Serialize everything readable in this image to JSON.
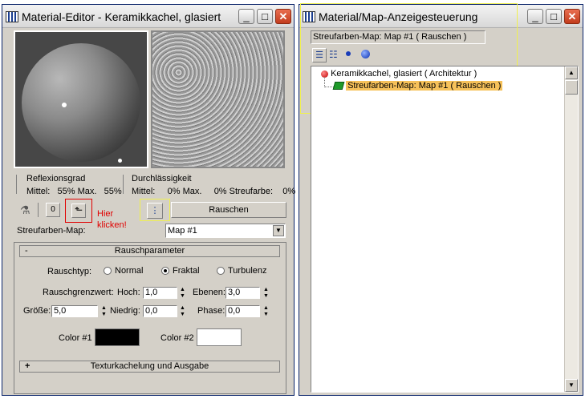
{
  "material_editor": {
    "title": "Material-Editor - Keramikkachel, glasiert",
    "reflection_label": "Reflexionsgrad",
    "reflection_values": "Mittel:   55% Max.   55%",
    "transparency_label": "Durchlässigkeit",
    "transparency_values": "Mittel:     0% Max.     0% Streufarbe:    0%",
    "hint_line1": "Hier",
    "hint_line2": "klicken!",
    "map_type_button": "Rauschen",
    "map_label": "Streufarben-Map:",
    "map_select_value": "Map #1",
    "noise_section": {
      "toggle": "-",
      "title": "Rauschparameter",
      "noise_type_label": "Rauschtyp:",
      "options": [
        "Normal",
        "Fraktal",
        "Turbulenz"
      ],
      "selected_option": "Fraktal",
      "threshold_label": "Rauschgrenzwert:",
      "high_label": "Hoch:",
      "high_value": "1,0",
      "levels_label": "Ebenen:",
      "levels_value": "3,0",
      "size_label": "Größe:",
      "size_value": "5,0",
      "low_label": "Niedrig:",
      "low_value": "0,0",
      "phase_label": "Phase:",
      "phase_value": "0,0",
      "color1_label": "Color #1",
      "color1": "#000000",
      "color2_label": "Color #2",
      "color2": "#ffffff"
    },
    "tiling_section": {
      "toggle": "+",
      "title": "Texturkachelung und Ausgabe"
    },
    "hint_color": "#e00000"
  },
  "map_navigator": {
    "title": "Material/Map-Anzeigesteuerung",
    "current_path": "Streufarben-Map: Map #1  ( Rauschen )",
    "tree": [
      {
        "label": "Keramikkachel, glasiert  ( Architektur )",
        "icon": "red-sphere-icon"
      },
      {
        "label": "Streufarben-Map: Map #1  ( Rauschen )",
        "icon": "green-map-icon",
        "selected": true
      }
    ],
    "highlight_color": "#f6c15a"
  },
  "annotation_colors": {
    "yellow_box": "#f0f050",
    "red_box": "#e00000"
  }
}
